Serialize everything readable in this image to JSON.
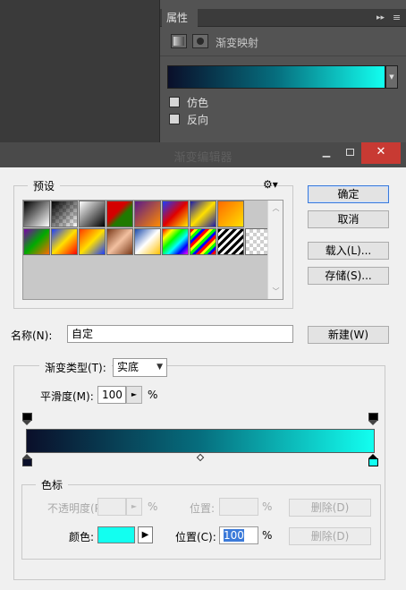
{
  "properties_panel": {
    "tab_label": "属性",
    "panel_title": "渐变映射",
    "dither_label": "仿色",
    "reverse_label": "反向"
  },
  "dialog": {
    "title": "渐变编辑器",
    "presets_group": "预设",
    "buttons": {
      "ok": "确定",
      "cancel": "取消",
      "load": "载入(L)...",
      "save": "存储(S)...",
      "new": "新建(W)"
    },
    "name_label": "名称(N):",
    "name_value": "自定",
    "gradient_type_label": "渐变类型(T):",
    "gradient_type_value": "实底",
    "smoothness_label": "平滑度(M):",
    "smoothness_value": "100",
    "smoothness_unit": "%",
    "stops_group": "色标",
    "opacity_label": "不透明度(P):",
    "opacity_unit": "%",
    "position_top_label": "位置:",
    "position_top_unit": "%",
    "delete_top": "删除(D)",
    "color_label": "颜色:",
    "position_label": "位置(C):",
    "position_value": "100",
    "position_unit": "%",
    "delete_bottom": "删除(D)"
  },
  "colors": {
    "gradient_start": "#0a0f2a",
    "gradient_mid": "#066e7e",
    "gradient_end": "#12fff0",
    "selected_stop_color": "#12fff0"
  },
  "icons": {
    "gear": "gear-icon",
    "panel_menu": "panel-menu-icon",
    "dropdown": "chevron-down-icon"
  }
}
